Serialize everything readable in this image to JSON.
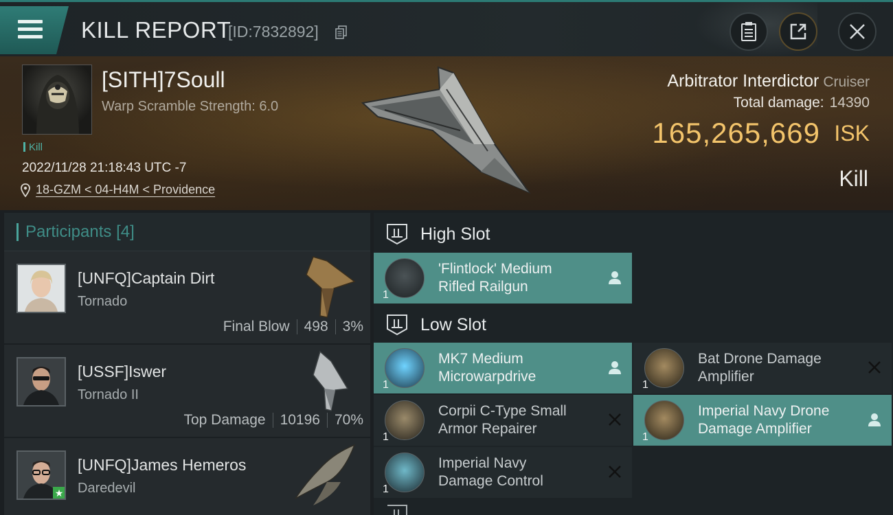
{
  "header": {
    "title": "KILL REPORT",
    "id_text": "[ID:7832892]",
    "icons": [
      "menu-icon",
      "copy-icon",
      "clipboard-icon",
      "share-icon",
      "close-icon"
    ]
  },
  "victim": {
    "name": "[SITH]7Soull",
    "warp_strength": "Warp Scramble Strength: 6.0",
    "tag": "Kill",
    "datetime": "2022/11/28 21:18:43 UTC -7",
    "location": "18-GZM < 04-H4M < Providence",
    "ship_name": "Arbitrator Interdictor",
    "ship_class": "Cruiser",
    "total_damage_label": "Total damage:",
    "total_damage_value": "14390",
    "isk_value": "165,265,669",
    "isk_label": "ISK",
    "result": "Kill"
  },
  "participants": {
    "title": "Participants",
    "count": "[4]",
    "list": [
      {
        "name": "[UNFQ]Captain Dirt",
        "ship": "Tornado",
        "role": "Final Blow",
        "damage": "498",
        "percent": "3%"
      },
      {
        "name": "[USSF]Iswer",
        "ship": "Tornado II",
        "role": "Top Damage",
        "damage": "10196",
        "percent": "70%"
      },
      {
        "name": "[UNFQ]James Hemeros",
        "ship": "Daredevil"
      }
    ]
  },
  "fitting": {
    "high_slot_label": "High Slot",
    "low_slot_label": "Low Slot",
    "high_slot": [
      {
        "name_line1": "'Flintlock' Medium",
        "name_line2": "Rifled Railgun",
        "qty": "1",
        "status": "fitted"
      }
    ],
    "low_slot": [
      {
        "name_line1": "MK7 Medium",
        "name_line2": "Microwarpdrive",
        "qty": "1",
        "status": "fitted"
      },
      {
        "name_line1": "Bat Drone Damage",
        "name_line2": "Amplifier",
        "qty": "1",
        "status": "destroyed"
      },
      {
        "name_line1": "Corpii C-Type Small",
        "name_line2": "Armor Repairer",
        "qty": "1",
        "status": "destroyed"
      },
      {
        "name_line1": "Imperial Navy Drone",
        "name_line2": "Damage Amplifier",
        "qty": "1",
        "status": "fitted"
      },
      {
        "name_line1": "Imperial Navy",
        "name_line2": "Damage Control",
        "qty": "1",
        "status": "destroyed"
      }
    ]
  },
  "colors": {
    "accent": "#4f8f88",
    "isk": "#f3c46b",
    "header_tab": "#2f7c76"
  }
}
